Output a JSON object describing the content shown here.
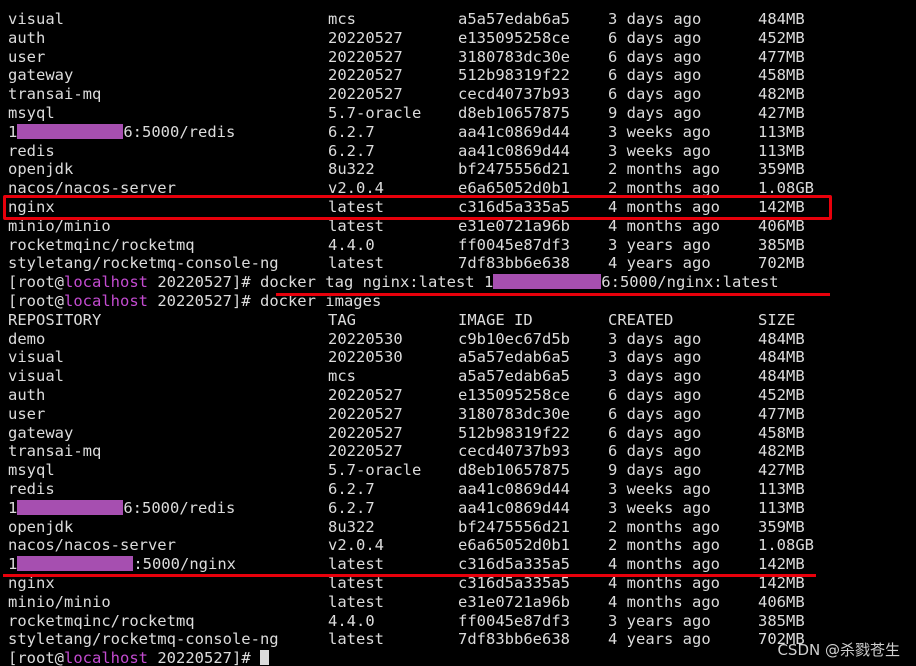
{
  "colors": {
    "background": "#000000",
    "text": "#dcdcdc",
    "hostname": "#c34bd0",
    "redaction": "#a64fb0",
    "annotation": "#e8000b"
  },
  "prompt": {
    "prefix": "[root@",
    "host": "localhost",
    "dir": " 20220527]# "
  },
  "commands": {
    "tag": "docker tag nginx:latest ",
    "tag_suffix": "6:5000/nginx:latest",
    "images": "docker images",
    "tag_prefix": "1"
  },
  "headers": [
    "REPOSITORY",
    "TAG",
    "IMAGE ID",
    "CREATED",
    "SIZE"
  ],
  "table1": [
    [
      "visual",
      "mcs",
      "a5a57edab6a5",
      "3 days ago",
      "484MB"
    ],
    [
      "auth",
      "20220527",
      "e135095258ce",
      "6 days ago",
      "452MB"
    ],
    [
      "user",
      "20220527",
      "3180783dc30e",
      "6 days ago",
      "477MB"
    ],
    [
      "gateway",
      "20220527",
      "512b98319f22",
      "6 days ago",
      "458MB"
    ],
    [
      "transai-mq",
      "20220527",
      "cecd40737b93",
      "6 days ago",
      "482MB"
    ],
    [
      "msyql",
      "5.7-oracle",
      "d8eb10657875",
      "9 days ago",
      "427MB"
    ],
    [
      "1|6:5000/redis",
      "6.2.7",
      "aa41c0869d44",
      "3 weeks ago",
      "113MB"
    ],
    [
      "redis",
      "6.2.7",
      "aa41c0869d44",
      "3 weeks ago",
      "113MB"
    ],
    [
      "openjdk",
      "8u322",
      "bf2475556d21",
      "2 months ago",
      "359MB"
    ],
    [
      "nacos/nacos-server",
      "v2.0.4",
      "e6a65052d0b1",
      "2 months ago",
      "1.08GB"
    ],
    [
      "nginx",
      "latest",
      "c316d5a335a5",
      "4 months ago",
      "142MB"
    ],
    [
      "minio/minio",
      "latest",
      "e31e0721a96b",
      "4 months ago",
      "406MB"
    ],
    [
      "rocketmqinc/rocketmq",
      "4.4.0",
      "ff0045e87df3",
      "3 years ago",
      "385MB"
    ],
    [
      "styletang/rocketmq-console-ng",
      "latest",
      "7df83bb6e638",
      "4 years ago",
      "702MB"
    ]
  ],
  "table2": [
    [
      "demo",
      "20220530",
      "c9b10ec67d5b",
      "3 days ago",
      "484MB"
    ],
    [
      "visual",
      "20220530",
      "a5a57edab6a5",
      "3 days ago",
      "484MB"
    ],
    [
      "visual",
      "mcs",
      "a5a57edab6a5",
      "3 days ago",
      "484MB"
    ],
    [
      "auth",
      "20220527",
      "e135095258ce",
      "6 days ago",
      "452MB"
    ],
    [
      "user",
      "20220527",
      "3180783dc30e",
      "6 days ago",
      "477MB"
    ],
    [
      "gateway",
      "20220527",
      "512b98319f22",
      "6 days ago",
      "458MB"
    ],
    [
      "transai-mq",
      "20220527",
      "cecd40737b93",
      "6 days ago",
      "482MB"
    ],
    [
      "msyql",
      "5.7-oracle",
      "d8eb10657875",
      "9 days ago",
      "427MB"
    ],
    [
      "redis",
      "6.2.7",
      "aa41c0869d44",
      "3 weeks ago",
      "113MB"
    ],
    [
      "1|6:5000/redis",
      "6.2.7",
      "aa41c0869d44",
      "3 weeks ago",
      "113MB"
    ],
    [
      "openjdk",
      "8u322",
      "bf2475556d21",
      "2 months ago",
      "359MB"
    ],
    [
      "nacos/nacos-server",
      "v2.0.4",
      "e6a65052d0b1",
      "2 months ago",
      "1.08GB"
    ],
    [
      "1|:5000/nginx",
      "latest",
      "c316d5a335a5",
      "4 months ago",
      "142MB"
    ],
    [
      "nginx",
      "latest",
      "c316d5a335a5",
      "4 months ago",
      "142MB"
    ],
    [
      "minio/minio",
      "latest",
      "e31e0721a96b",
      "4 months ago",
      "406MB"
    ],
    [
      "rocketmqinc/rocketmq",
      "4.4.0",
      "ff0045e87df3",
      "3 years ago",
      "385MB"
    ],
    [
      "styletang/rocketmq-console-ng",
      "latest",
      "7df83bb6e638",
      "4 years ago",
      "702MB"
    ]
  ],
  "watermark": "CSDN @杀戮苍生"
}
